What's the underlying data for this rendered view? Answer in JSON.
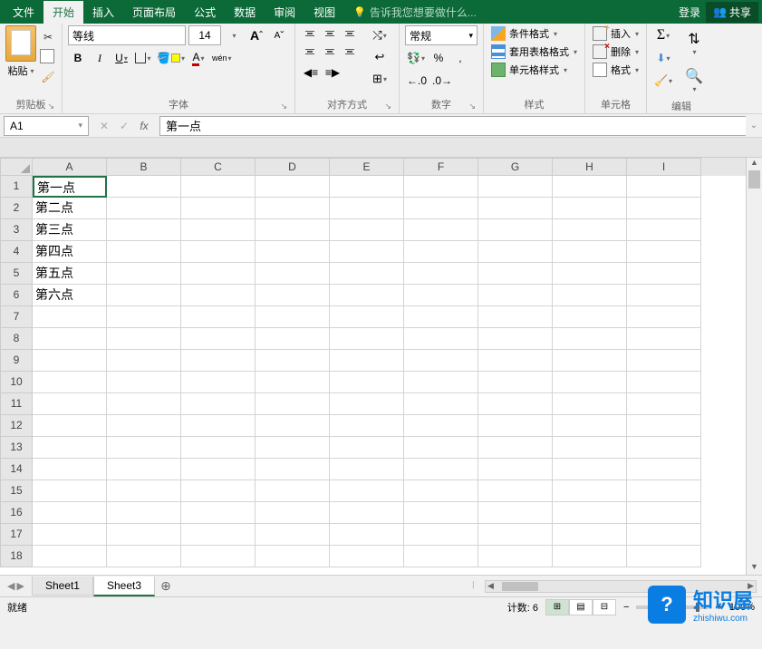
{
  "titlebar": {
    "tabs": [
      "文件",
      "开始",
      "插入",
      "页面布局",
      "公式",
      "数据",
      "审阅",
      "视图"
    ],
    "active_tab_index": 1,
    "tellme": "告诉我您想要做什么...",
    "login": "登录",
    "share": "共享"
  },
  "ribbon": {
    "clipboard": {
      "label": "剪贴板",
      "paste": "粘贴"
    },
    "font": {
      "label": "字体",
      "name": "等线",
      "size": "14",
      "bold": "B",
      "italic": "I",
      "underline": "U",
      "ruby": "wén"
    },
    "alignment": {
      "label": "对齐方式"
    },
    "number": {
      "label": "数字",
      "format": "常规",
      "percent": "%",
      "comma": ","
    },
    "styles": {
      "label": "样式",
      "conditional": "条件格式",
      "table": "套用表格格式",
      "cell": "单元格样式"
    },
    "cells": {
      "label": "单元格",
      "insert": "插入",
      "delete": "删除",
      "format": "格式"
    },
    "editing": {
      "label": "编辑",
      "sigma": "Σ"
    }
  },
  "formulabar": {
    "namebox": "A1",
    "formula": "第一点"
  },
  "grid": {
    "columns": [
      "A",
      "B",
      "C",
      "D",
      "E",
      "F",
      "G",
      "H",
      "I"
    ],
    "rows": [
      1,
      2,
      3,
      4,
      5,
      6,
      7,
      8,
      9,
      10,
      11,
      12,
      13,
      14,
      15,
      16,
      17,
      18
    ],
    "data": {
      "A1": "第一点",
      "A2": "第二点",
      "A3": "第三点",
      "A4": "第四点",
      "A5": "第五点",
      "A6": "第六点"
    },
    "selected": "A1"
  },
  "sheets": {
    "tabs": [
      "Sheet1",
      "Sheet3"
    ],
    "active_index": 1
  },
  "statusbar": {
    "ready": "就绪",
    "count_label": "计数:",
    "count_value": "6",
    "zoom": "100%"
  },
  "watermark": {
    "brand": "知识屋",
    "url": "zhishiwu.com",
    "badge": "?"
  }
}
